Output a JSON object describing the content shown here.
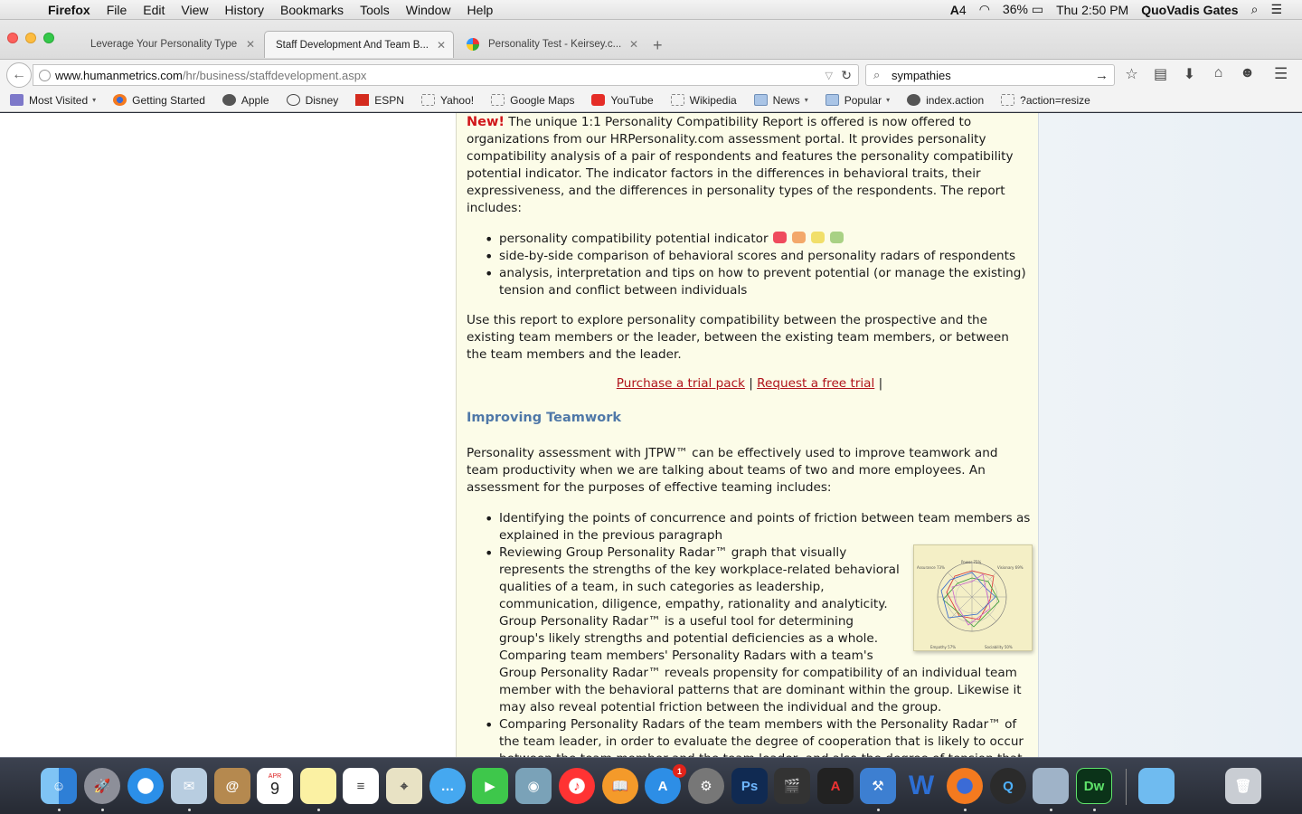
{
  "menubar": {
    "app": "Firefox",
    "items": [
      "File",
      "Edit",
      "View",
      "History",
      "Bookmarks",
      "Tools",
      "Window",
      "Help"
    ],
    "adobe_count": "4",
    "battery": "36%",
    "clock": "Thu 2:50 PM",
    "user": "QuoVadis Gates"
  },
  "tabs": [
    {
      "title": "Leverage Your Personality Type"
    },
    {
      "title": "Staff Development And Team B..."
    },
    {
      "title": "Personality Test - Keirsey.c..."
    }
  ],
  "nav": {
    "url_host": "www.humanmetrics.com",
    "url_path": "/hr/business/staffdevelopment.aspx",
    "search_value": "sympathies"
  },
  "bookmarks": [
    {
      "label": "Most Visited",
      "icon": "most-visited-icon",
      "caret": "▾"
    },
    {
      "label": "Getting Started",
      "icon": "firefox-icon"
    },
    {
      "label": "Apple",
      "icon": "apple-icon"
    },
    {
      "label": "Disney",
      "icon": "disney-icon"
    },
    {
      "label": "ESPN",
      "icon": "espn-icon"
    },
    {
      "label": "Yahoo!",
      "icon": "page-icon"
    },
    {
      "label": "Google Maps",
      "icon": "page-icon"
    },
    {
      "label": "YouTube",
      "icon": "youtube-icon"
    },
    {
      "label": "Wikipedia",
      "icon": "page-icon"
    },
    {
      "label": "News",
      "icon": "folder-icon",
      "caret": "▾"
    },
    {
      "label": "Popular",
      "icon": "folder-icon",
      "caret": "▾"
    },
    {
      "label": "index.action",
      "icon": "apple-icon"
    },
    {
      "label": "?action=resize",
      "icon": "page-icon"
    }
  ],
  "article": {
    "new_label": "New!",
    "intro": " The unique 1:1 Personality Compatibility Report is offered is now offered to organizations from our HRPersonality.com assessment portal. It provides personality compatibility analysis of a pair of respondents and features the personality compatibility potential indicator. The indicator factors in the differences in behavioral traits, their expressiveness, and the differences in personality types of the respondents. The report includes:",
    "report_items": [
      "personality compatibility potential indicator",
      "side-by-side comparison of behavioral scores and personality radars of respondents",
      "analysis, interpretation and tips on how to prevent potential (or manage the existing) tension and conflict between individuals"
    ],
    "indicator_colors": [
      "#ef4b5d",
      "#f3a86a",
      "#f1df6a",
      "#a9d184"
    ],
    "use_text": "Use this report to explore personality compatibility between the prospective and the existing team members or the leader, between the existing team members, or between the team members and the leader.",
    "link_purchase": "Purchase a trial pack",
    "link_request": "Request a free trial",
    "sep1": " | ",
    "sep2": " |",
    "heading": "Improving Teamwork",
    "teamwork_intro": "Personality assessment with JTPW™ can be effectively used to improve teamwork and team productivity when we are talking about teams of two and more employees. An assessment for the purposes of effective teaming includes:",
    "team_items": [
      "Identifying the points of concurrence and points of friction between team members as explained in the previous paragraph",
      "Reviewing Group Personality Radar™ graph that visually represents the strengths of the key workplace-related behavioral qualities of a team, in such categories as leadership, communication, diligence, empathy, rationality and analyticity. Group Personality Radar™ is a useful tool for determining group's likely strengths and potential deficiencies as a whole. Comparing team members' Personality Radars with a team's Group Personality Radar™ reveals propensity for compatibility of an individual team member with the behavioral patterns that are dominant within the group. Likewise it may also reveal potential friction between the individual and the group.",
      "Comparing Personality Radars of the team members with the Personality Radar™ of the team leader, in order to evaluate the degree of cooperation that is likely to occur between the team member and the team leader, and also the degree of tension that may potentially"
    ],
    "radar_labels": [
      "Power 75%",
      "Visionary 69%",
      "Assurance 73%",
      "Empathy 57%",
      "Sociability 50%"
    ]
  },
  "dock": {
    "calendar_month": "APR",
    "calendar_day": "9",
    "appstore_badge": "1",
    "photoshop": "Ps",
    "dreamweaver": "Dw"
  }
}
